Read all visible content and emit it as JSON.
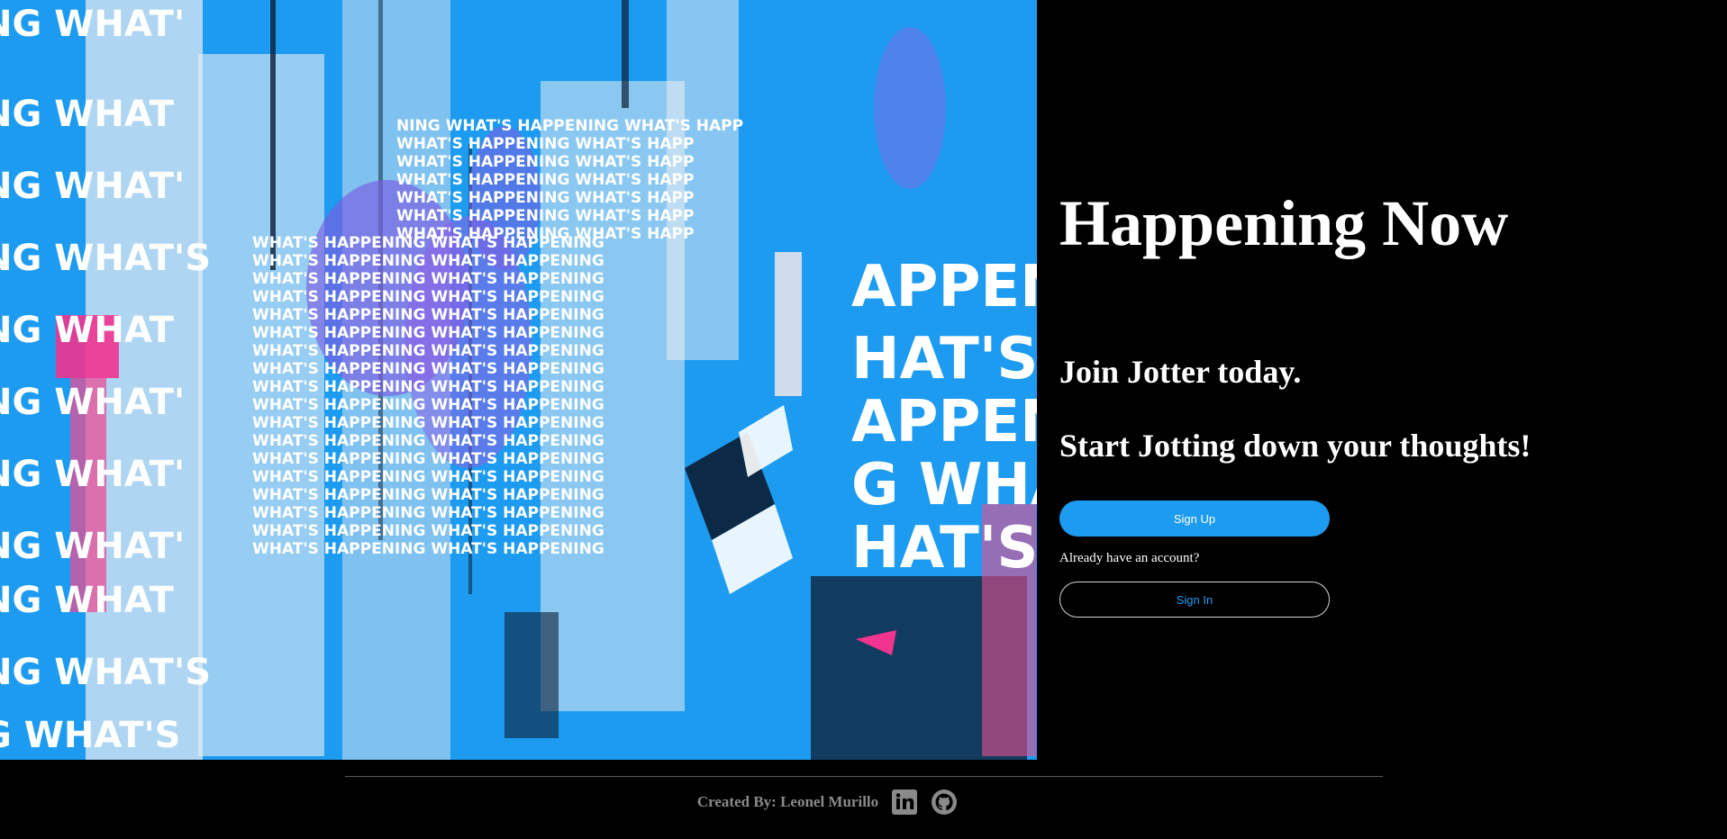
{
  "hero": {
    "image_alt": "WHAT'S HAPPENING collage artwork",
    "poster_words": [
      "WHAT'S HAPPENING",
      "NG WHAT'S",
      "HAPPENING"
    ]
  },
  "main": {
    "title": "Happening Now",
    "subtitle_1": "Join Jotter today.",
    "subtitle_2": "Start Jotting down your thoughts!",
    "signup_label": "Sign Up",
    "have_account_text": "Already have an account?",
    "signin_label": "Sign In"
  },
  "footer": {
    "credit": "Created By: Leonel Murillo",
    "icons": [
      "linkedin-icon",
      "github-icon"
    ]
  },
  "colors": {
    "accent": "#1d9bf0",
    "background": "#000000",
    "text": "#ffffff",
    "footer_text": "#8a8a8a"
  }
}
